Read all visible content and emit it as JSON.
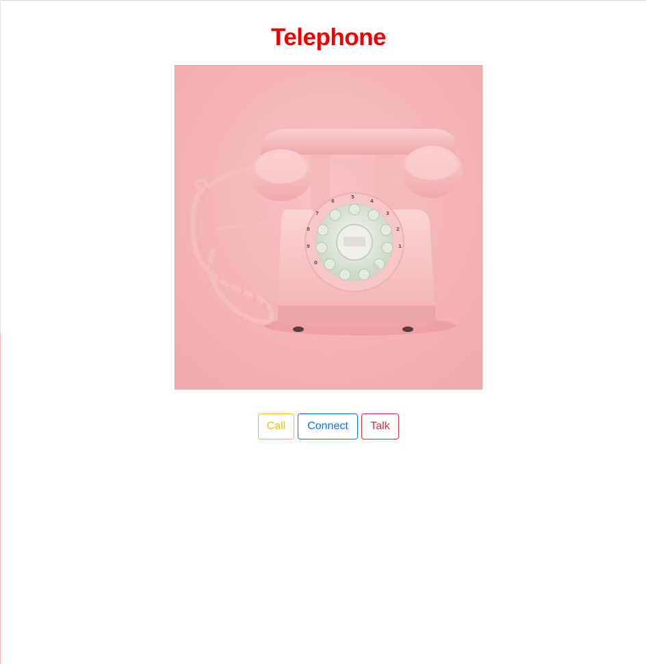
{
  "page": {
    "title": "Telephone"
  },
  "image": {
    "alt": "Telephone",
    "icon": "rotary-telephone-photo"
  },
  "buttons": {
    "call": "Call",
    "connect": "Connect",
    "talk": "Talk"
  },
  "dial": {
    "numbers": [
      "1",
      "2",
      "3",
      "4",
      "5",
      "6",
      "7",
      "8",
      "9",
      "0"
    ]
  },
  "colors": {
    "title": "#ee0000",
    "call": "#f5c000",
    "connect": "#0d6efd",
    "talk": "#cf3340",
    "image_background": "#f6b5b8"
  }
}
